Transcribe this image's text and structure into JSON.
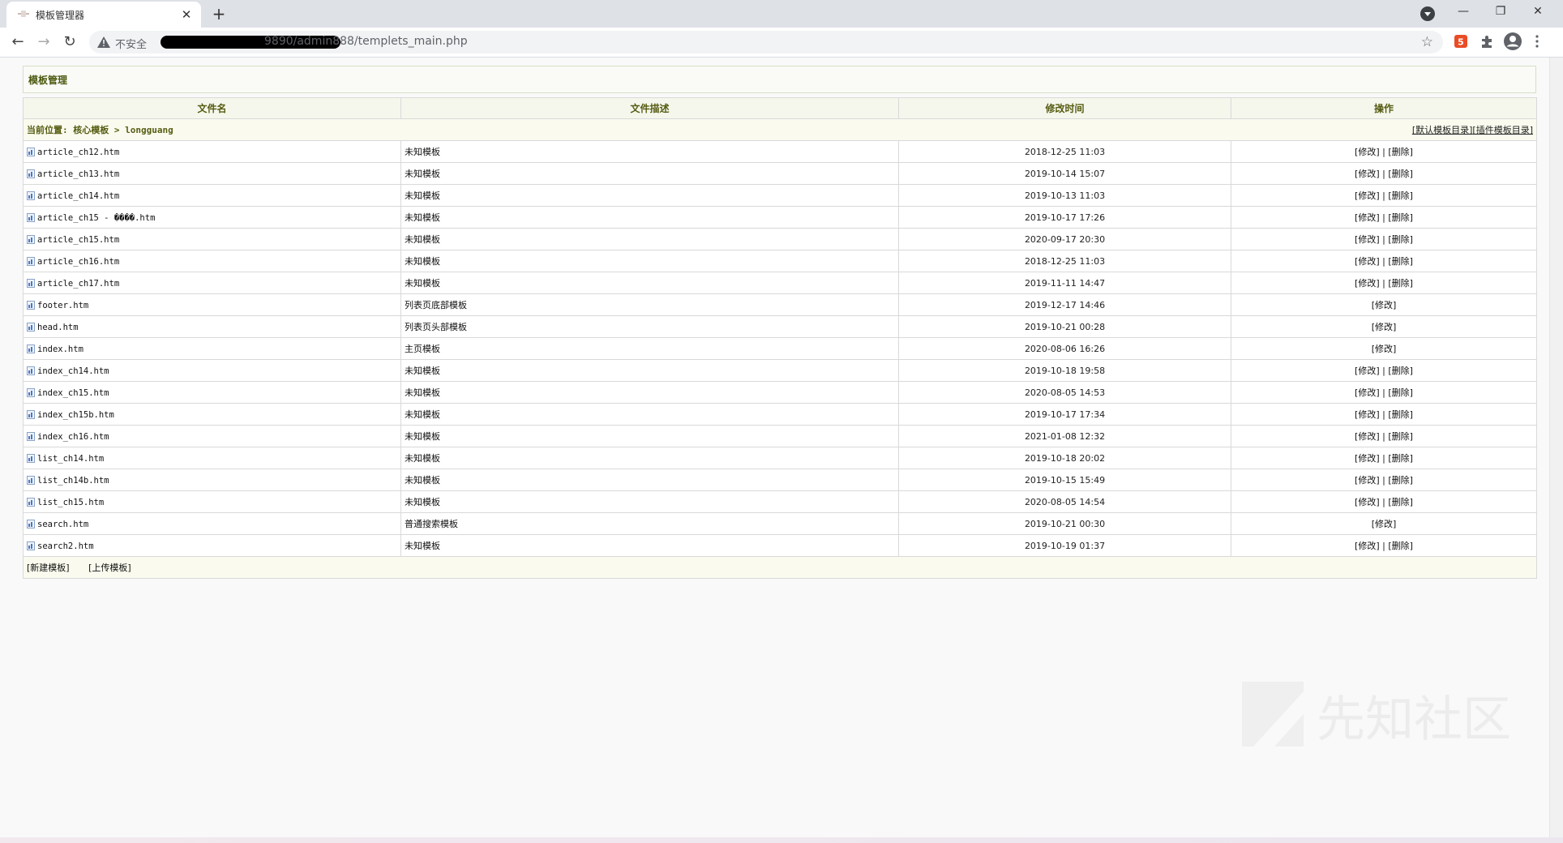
{
  "browser": {
    "tab_title": "模板管理器",
    "tab_close": "✕",
    "new_tab": "+",
    "win_minimize": "—",
    "win_restore": "❐",
    "win_close": "✕",
    "security_label": "不安全",
    "url_tail": "9890/admin888/templets_main.php"
  },
  "panel": {
    "title": "模板管理"
  },
  "table": {
    "headers": [
      "文件名",
      "文件描述",
      "修改时间",
      "操作"
    ],
    "breadcrumb": "当前位置: 核心模板 > longguang",
    "default_dir": "[默认模板目录]",
    "plugin_dir": "[插件模板目录]",
    "edit_label": "[修改]",
    "sep": " | ",
    "delete_label": "[删除]",
    "rows": [
      {
        "name": "article_ch12.htm",
        "desc": "未知模板",
        "time": "2018-12-25 11:03",
        "deletable": true
      },
      {
        "name": "article_ch13.htm",
        "desc": "未知模板",
        "time": "2019-10-14 15:07",
        "deletable": true
      },
      {
        "name": "article_ch14.htm",
        "desc": "未知模板",
        "time": "2019-10-13 11:03",
        "deletable": true
      },
      {
        "name": "article_ch15 - ����.htm",
        "desc": "未知模板",
        "time": "2019-10-17 17:26",
        "deletable": true
      },
      {
        "name": "article_ch15.htm",
        "desc": "未知模板",
        "time": "2020-09-17 20:30",
        "deletable": true
      },
      {
        "name": "article_ch16.htm",
        "desc": "未知模板",
        "time": "2018-12-25 11:03",
        "deletable": true
      },
      {
        "name": "article_ch17.htm",
        "desc": "未知模板",
        "time": "2019-11-11 14:47",
        "deletable": true
      },
      {
        "name": "footer.htm",
        "desc": "列表页底部模板",
        "time": "2019-12-17 14:46",
        "deletable": false
      },
      {
        "name": "head.htm",
        "desc": "列表页头部模板",
        "time": "2019-10-21 00:28",
        "deletable": false
      },
      {
        "name": "index.htm",
        "desc": "主页模板",
        "time": "2020-08-06 16:26",
        "deletable": false
      },
      {
        "name": "index_ch14.htm",
        "desc": "未知模板",
        "time": "2019-10-18 19:58",
        "deletable": true
      },
      {
        "name": "index_ch15.htm",
        "desc": "未知模板",
        "time": "2020-08-05 14:53",
        "deletable": true
      },
      {
        "name": "index_ch15b.htm",
        "desc": "未知模板",
        "time": "2019-10-17 17:34",
        "deletable": true
      },
      {
        "name": "index_ch16.htm",
        "desc": "未知模板",
        "time": "2021-01-08 12:32",
        "deletable": true
      },
      {
        "name": "list_ch14.htm",
        "desc": "未知模板",
        "time": "2019-10-18 20:02",
        "deletable": true
      },
      {
        "name": "list_ch14b.htm",
        "desc": "未知模板",
        "time": "2019-10-15 15:49",
        "deletable": true
      },
      {
        "name": "list_ch15.htm",
        "desc": "未知模板",
        "time": "2020-08-05 14:54",
        "deletable": true
      },
      {
        "name": "search.htm",
        "desc": "普通搜索模板",
        "time": "2019-10-21 00:30",
        "deletable": false
      },
      {
        "name": "search2.htm",
        "desc": "未知模板",
        "time": "2019-10-19 01:37",
        "deletable": true
      }
    ],
    "new_template": "[新建模板]",
    "upload_template": "[上传模板]"
  },
  "watermark": {
    "text": "先知社区"
  },
  "colors": {
    "header_text": "#565c12",
    "row_bg": "#fafbee"
  }
}
